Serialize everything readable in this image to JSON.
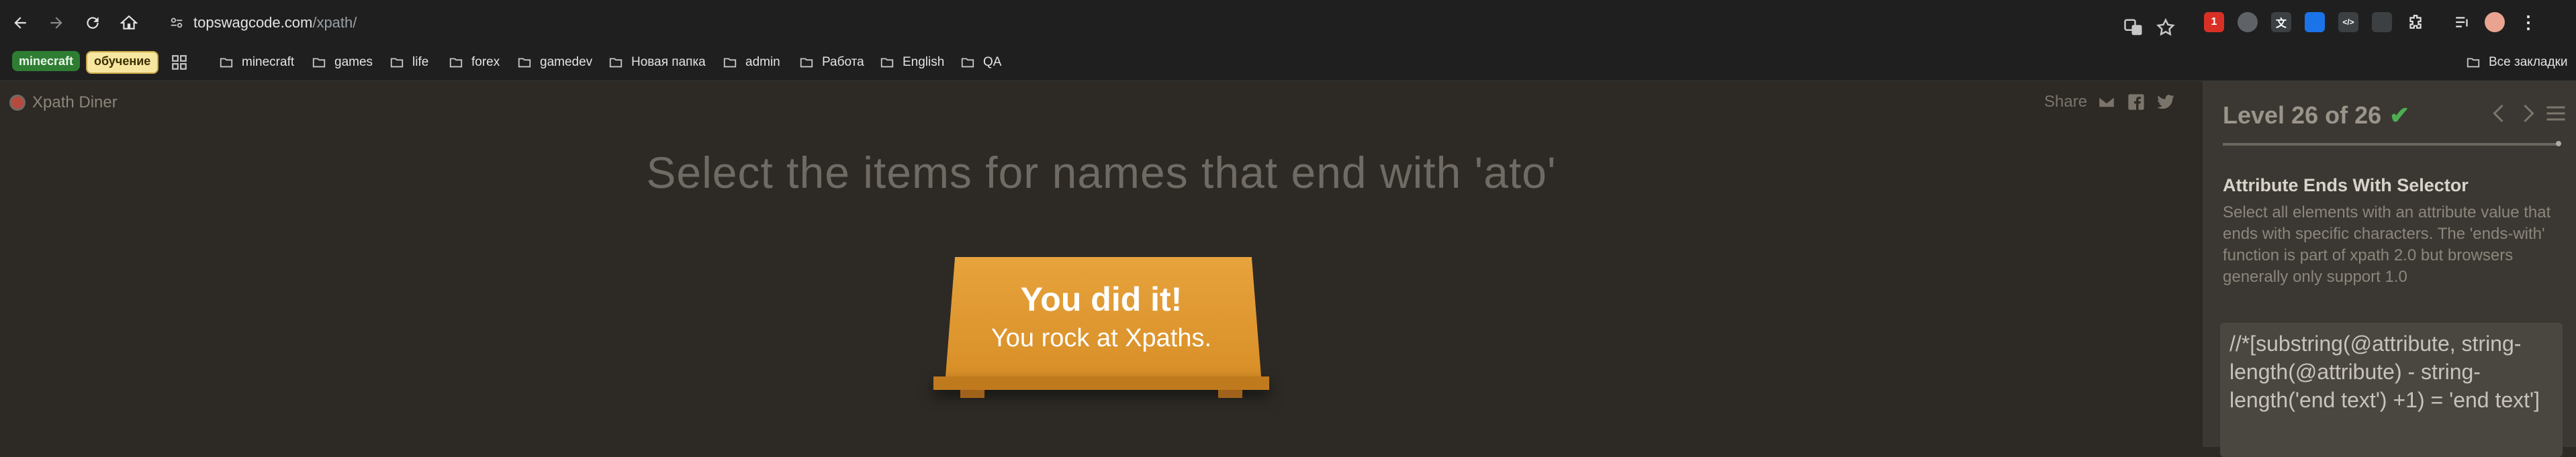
{
  "browser": {
    "url_host": "topswagcode.com",
    "url_path": "/xpath/",
    "extensions": [
      {
        "name": "extension-red-badge",
        "label": "1",
        "color": "#d93025"
      },
      {
        "name": "extension-circle",
        "label": "",
        "color": "#9aa0a6"
      },
      {
        "name": "extension-translate",
        "label": "文",
        "color": "#5f6368"
      },
      {
        "name": "extension-square",
        "label": "",
        "color": "#1a73e8"
      },
      {
        "name": "extension-code",
        "label": "</>",
        "color": "#3c4043"
      },
      {
        "name": "extension-image",
        "label": "",
        "color": "#3c4043"
      }
    ]
  },
  "bookmarks": {
    "chips": [
      {
        "label": "minecraft",
        "color": "#2e7d32"
      },
      {
        "label": "обучение",
        "color": "#f6e6a0"
      }
    ],
    "folders": [
      "minecraft",
      "games",
      "life",
      "forex",
      "gamedev",
      "Новая папка",
      "admin",
      "Работа",
      "English",
      "QA"
    ],
    "all_bookmarks": "Все закладки"
  },
  "page": {
    "brand": "Xpath Diner",
    "share_label": "Share",
    "order": "Select the items for names that end with 'ato'",
    "table": {
      "line1": "You did it!",
      "line2": "You rock at Xpaths."
    }
  },
  "sidebar": {
    "level_text": "Level 26 of 26",
    "level_current": 26,
    "level_total": 26,
    "completed": true,
    "selector_title": "Attribute Ends With Selector",
    "selector_description": "Select all elements with an attribute value that ends with specific characters. The 'ends-with' function is part of xpath 2.0 but browsers generally only support 1.0",
    "syntax": "//*[substring(@attribute, string-length(@attribute) - string-length('end text') +1) = 'end text']"
  },
  "colors": {
    "accent_green": "#4caf50",
    "table_orange": "#e7a33c",
    "page_bg": "#2d2a25",
    "sidebar_bg": "#3b3833"
  }
}
